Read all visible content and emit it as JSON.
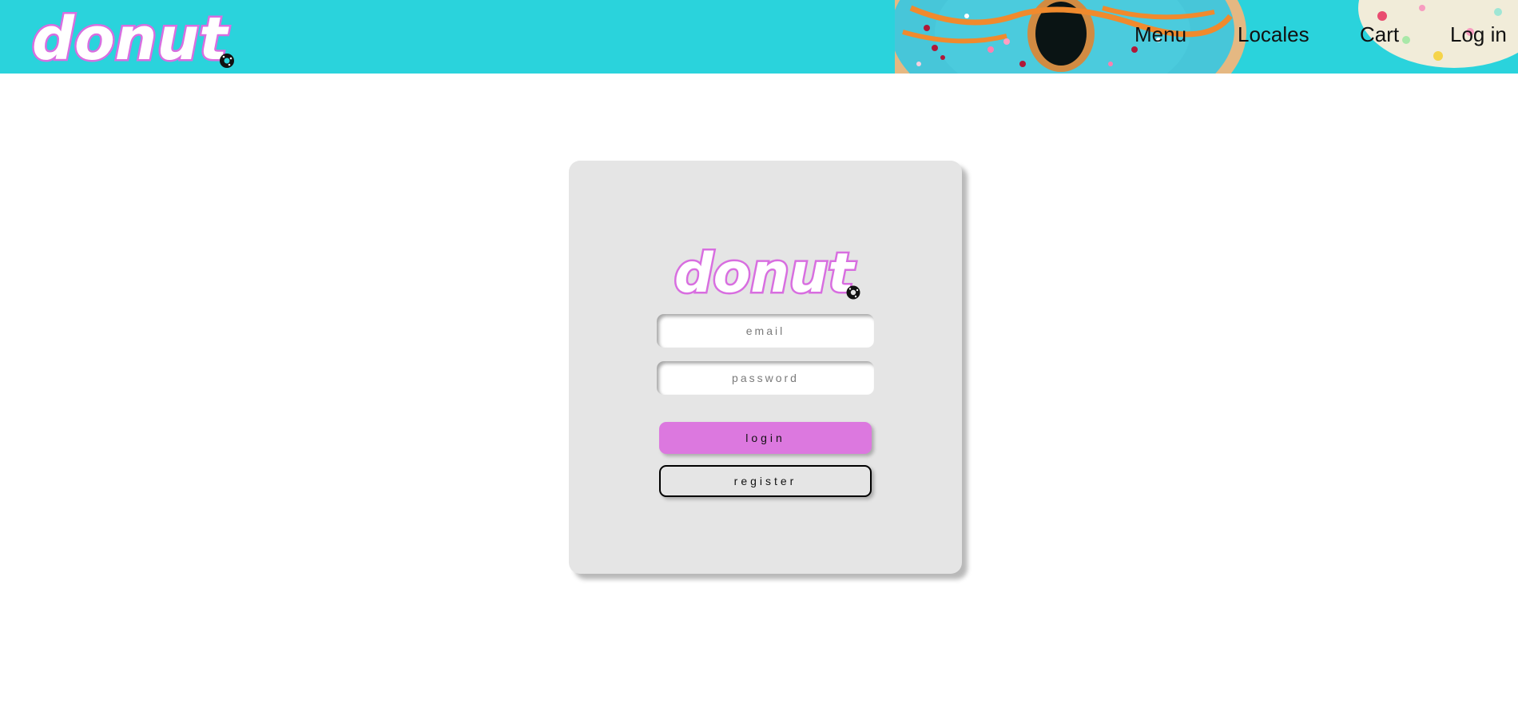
{
  "header": {
    "logo_text": "donut",
    "nav": {
      "menu": "Menu",
      "locales": "Locales",
      "cart": "Cart",
      "login": "Log in"
    }
  },
  "login_card": {
    "logo_text": "donut",
    "email_placeholder": "email",
    "password_placeholder": "password",
    "login_label": "login",
    "register_label": "register"
  },
  "colors": {
    "header_background": "#2ad3dc",
    "card_background": "#e5e5e5",
    "login_button": "#dc78df",
    "logo_fill": "#ffffff",
    "logo_outline": "#d86ee0"
  },
  "icons": [
    "donut-logo",
    "donut-icon"
  ]
}
